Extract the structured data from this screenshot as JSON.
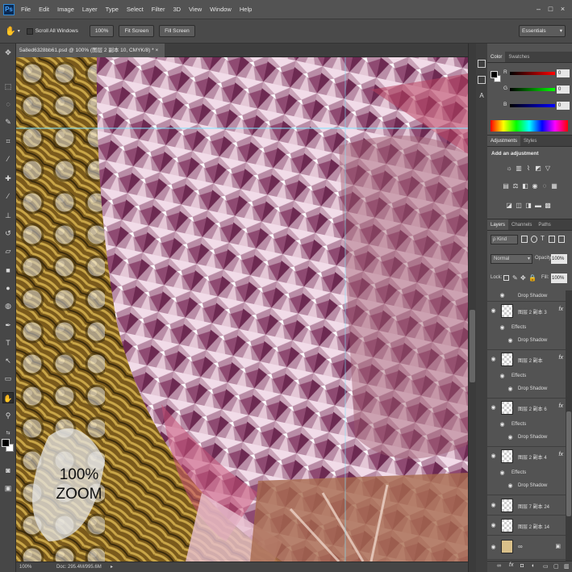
{
  "app": {
    "logo": "Ps",
    "window_controls": [
      "–",
      "□",
      "×"
    ]
  },
  "menu": [
    "File",
    "Edit",
    "Image",
    "Layer",
    "Type",
    "Select",
    "Filter",
    "3D",
    "View",
    "Window",
    "Help"
  ],
  "options_bar": {
    "tool_icon": "hand-icon",
    "scroll_all_windows": "Scroll All Windows",
    "btn_100": "100%",
    "btn_fit": "Fit Screen",
    "btn_fill": "Fill Screen",
    "workspace": "Essentials"
  },
  "document": {
    "tab_label": "5a8ed6328bb61.psd @ 100% (图层 2 副本 10, CMYK/8) * ×",
    "zoom_overlay_line1": "100%",
    "zoom_overlay_line2": "ZOOM",
    "status_zoom": "100%",
    "status_doc": "Doc: 295.4M/995.6M"
  },
  "color_panel": {
    "tabs": [
      "Color",
      "Swatches"
    ],
    "channels": [
      {
        "label": "R",
        "value": "0",
        "color": "#ff0000"
      },
      {
        "label": "G",
        "value": "0",
        "color": "#00ff00"
      },
      {
        "label": "B",
        "value": "0",
        "color": "#0000ff"
      }
    ]
  },
  "adjustments_panel": {
    "tabs": [
      "Adjustments",
      "Styles"
    ],
    "heading": "Add an adjustment"
  },
  "layers_panel": {
    "tabs": [
      "Layers",
      "Channels",
      "Paths"
    ],
    "filter_kind": "ρ Kind",
    "blend_mode": "Normal",
    "opacity_label": "Opacity:",
    "opacity_value": "100%",
    "lock_label": "Lock:",
    "fill_label": "Fill:",
    "fill_value": "100%",
    "top_sub": "Drop Shadow",
    "layers": [
      {
        "name": "图层 2 副本 3",
        "fx": "fx",
        "effects": "Effects",
        "drop": "Drop Shadow"
      },
      {
        "name": "图层 2 副本",
        "fx": "fx",
        "effects": "Effects",
        "drop": "Drop Shadow"
      },
      {
        "name": "图层 2 副本 6",
        "fx": "fx",
        "effects": "Effects",
        "drop": "Drop Shadow"
      },
      {
        "name": "图层 2 副本 4",
        "fx": "fx",
        "effects": "Effects",
        "drop": "Drop Shadow"
      },
      {
        "name": "图层 7 副本 24",
        "fx": "",
        "effects": "",
        "drop": ""
      },
      {
        "name": "图层 2 副本 14",
        "fx": "",
        "effects": "",
        "drop": ""
      },
      {
        "name": "",
        "fx": "",
        "effects": "",
        "drop": ""
      }
    ]
  },
  "icons": {
    "toolbar": [
      "move-icon",
      "marquee-icon",
      "lasso-icon",
      "quick-select-icon",
      "crop-icon",
      "eyedropper-icon",
      "healing-icon",
      "brush-icon",
      "stamp-icon",
      "history-brush-icon",
      "eraser-icon",
      "gradient-icon",
      "blur-icon",
      "dodge-icon",
      "pen-icon",
      "type-icon",
      "path-select-icon",
      "shape-icon",
      "hand-icon",
      "zoom-icon"
    ]
  }
}
